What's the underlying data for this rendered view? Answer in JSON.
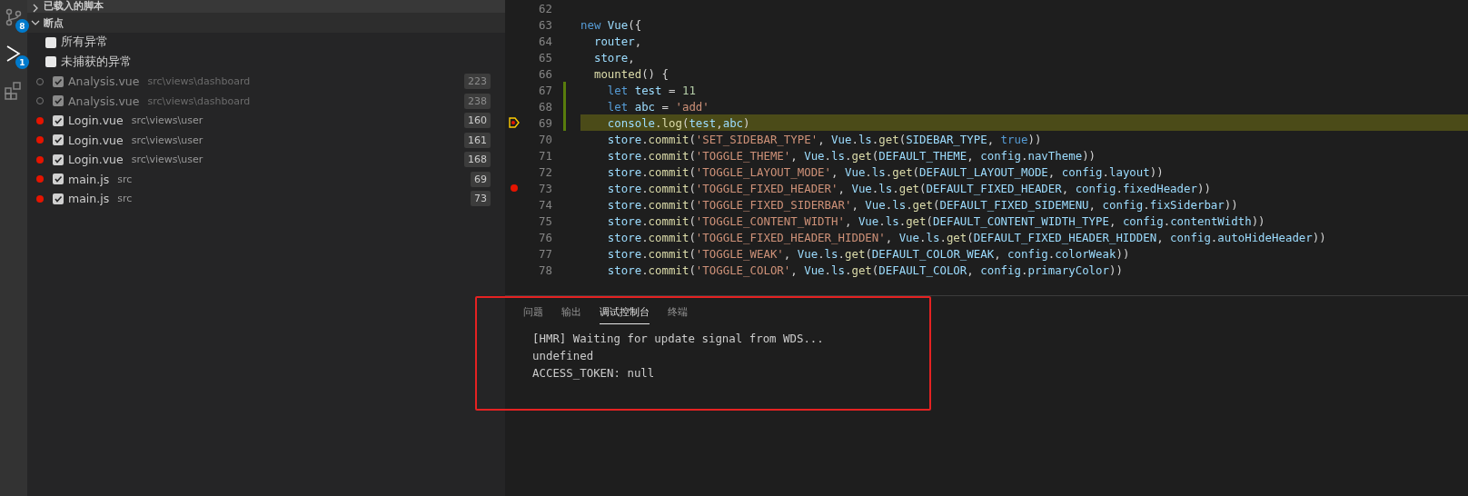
{
  "activity_bar": {
    "badges": [
      {
        "kind": "scm",
        "count": "8"
      },
      {
        "kind": "debug",
        "count": "1"
      },
      {
        "kind": "extensions"
      }
    ]
  },
  "sidebar": {
    "sections": [
      {
        "title": "已载入的脚本",
        "expanded": false
      },
      {
        "title": "断点",
        "expanded": true
      }
    ],
    "breakpoints": [
      {
        "kind": "exception",
        "label": "所有异常",
        "checked": false
      },
      {
        "kind": "exception",
        "label": "未捕获的异常",
        "checked": false
      },
      {
        "kind": "breakpoint",
        "label": "Analysis.vue",
        "path": "src\\views\\dashboard",
        "line": "223",
        "checked": true,
        "verified": false
      },
      {
        "kind": "breakpoint",
        "label": "Analysis.vue",
        "path": "src\\views\\dashboard",
        "line": "238",
        "checked": true,
        "verified": false
      },
      {
        "kind": "breakpoint",
        "label": "Login.vue",
        "path": "src\\views\\user",
        "line": "160",
        "checked": true,
        "verified": true
      },
      {
        "kind": "breakpoint",
        "label": "Login.vue",
        "path": "src\\views\\user",
        "line": "161",
        "checked": true,
        "verified": true
      },
      {
        "kind": "breakpoint",
        "label": "Login.vue",
        "path": "src\\views\\user",
        "line": "168",
        "checked": true,
        "verified": true
      },
      {
        "kind": "breakpoint",
        "label": "main.js",
        "path": "src",
        "line": "69",
        "checked": true,
        "verified": true
      },
      {
        "kind": "breakpoint",
        "label": "main.js",
        "path": "src",
        "line": "73",
        "checked": true,
        "verified": true
      }
    ]
  },
  "editor": {
    "lines": [
      {
        "number": "62",
        "breakpoint": false,
        "current": false,
        "modified": false
      },
      {
        "number": "63",
        "breakpoint": false,
        "current": false,
        "modified": false,
        "tokens": [
          {
            "kind": "keyword",
            "text": "new "
          },
          {
            "kind": "variable",
            "text": "Vue"
          },
          {
            "kind": "plain",
            "text": "({"
          }
        ]
      },
      {
        "number": "64",
        "breakpoint": false,
        "current": false,
        "modified": false,
        "tokens": [
          {
            "kind": "variable",
            "text": "  router"
          },
          {
            "kind": "plain",
            "text": ","
          }
        ]
      },
      {
        "number": "65",
        "breakpoint": false,
        "current": false,
        "modified": false,
        "tokens": [
          {
            "kind": "variable",
            "text": "  store"
          },
          {
            "kind": "plain",
            "text": ","
          }
        ]
      },
      {
        "number": "66",
        "breakpoint": false,
        "current": false,
        "modified": false,
        "tokens": [
          {
            "kind": "function",
            "text": "  mounted"
          },
          {
            "kind": "plain",
            "text": "() {"
          }
        ]
      },
      {
        "number": "67",
        "breakpoint": false,
        "current": false,
        "modified": true,
        "tokens": [
          {
            "kind": "keyword",
            "text": "    let "
          },
          {
            "kind": "variable",
            "text": "test"
          },
          {
            "kind": "plain",
            "text": " = "
          },
          {
            "kind": "number",
            "text": "11"
          }
        ]
      },
      {
        "number": "68",
        "breakpoint": false,
        "current": false,
        "modified": true,
        "tokens": [
          {
            "kind": "keyword",
            "text": "    let "
          },
          {
            "kind": "variable",
            "text": "abc"
          },
          {
            "kind": "plain",
            "text": " = "
          },
          {
            "kind": "string",
            "text": "'add'"
          }
        ]
      },
      {
        "number": "69",
        "breakpoint": true,
        "current": true,
        "modified": true,
        "tokens": [
          {
            "kind": "variable",
            "text": "    console"
          },
          {
            "kind": "plain",
            "text": "."
          },
          {
            "kind": "function",
            "text": "log"
          },
          {
            "kind": "plain",
            "text": "("
          },
          {
            "kind": "variable",
            "text": "test"
          },
          {
            "kind": "plain",
            "text": ","
          },
          {
            "kind": "variable",
            "text": "abc"
          },
          {
            "kind": "plain",
            "text": ")"
          }
        ]
      },
      {
        "number": "70",
        "breakpoint": false,
        "current": false,
        "modified": false,
        "tokens": [
          {
            "kind": "variable",
            "text": "    store"
          },
          {
            "kind": "plain",
            "text": "."
          },
          {
            "kind": "function",
            "text": "commit"
          },
          {
            "kind": "plain",
            "text": "("
          },
          {
            "kind": "string",
            "text": "'SET_SIDEBAR_TYPE'"
          },
          {
            "kind": "plain",
            "text": ", "
          },
          {
            "kind": "variable",
            "text": "Vue"
          },
          {
            "kind": "plain",
            "text": "."
          },
          {
            "kind": "variable",
            "text": "ls"
          },
          {
            "kind": "plain",
            "text": "."
          },
          {
            "kind": "function",
            "text": "get"
          },
          {
            "kind": "plain",
            "text": "("
          },
          {
            "kind": "variable",
            "text": "SIDEBAR_TYPE"
          },
          {
            "kind": "plain",
            "text": ", "
          },
          {
            "kind": "keyword",
            "text": "true"
          },
          {
            "kind": "plain",
            "text": "))"
          }
        ]
      },
      {
        "number": "71",
        "breakpoint": false,
        "current": false,
        "modified": false,
        "tokens": [
          {
            "kind": "variable",
            "text": "    store"
          },
          {
            "kind": "plain",
            "text": "."
          },
          {
            "kind": "function",
            "text": "commit"
          },
          {
            "kind": "plain",
            "text": "("
          },
          {
            "kind": "string",
            "text": "'TOGGLE_THEME'"
          },
          {
            "kind": "plain",
            "text": ", "
          },
          {
            "kind": "variable",
            "text": "Vue"
          },
          {
            "kind": "plain",
            "text": "."
          },
          {
            "kind": "variable",
            "text": "ls"
          },
          {
            "kind": "plain",
            "text": "."
          },
          {
            "kind": "function",
            "text": "get"
          },
          {
            "kind": "plain",
            "text": "("
          },
          {
            "kind": "variable",
            "text": "DEFAULT_THEME"
          },
          {
            "kind": "plain",
            "text": ", "
          },
          {
            "kind": "variable",
            "text": "config"
          },
          {
            "kind": "plain",
            "text": "."
          },
          {
            "kind": "variable",
            "text": "navTheme"
          },
          {
            "kind": "plain",
            "text": "))"
          }
        ]
      },
      {
        "number": "72",
        "breakpoint": false,
        "current": false,
        "modified": false,
        "tokens": [
          {
            "kind": "variable",
            "text": "    store"
          },
          {
            "kind": "plain",
            "text": "."
          },
          {
            "kind": "function",
            "text": "commit"
          },
          {
            "kind": "plain",
            "text": "("
          },
          {
            "kind": "string",
            "text": "'TOGGLE_LAYOUT_MODE'"
          },
          {
            "kind": "plain",
            "text": ", "
          },
          {
            "kind": "variable",
            "text": "Vue"
          },
          {
            "kind": "plain",
            "text": "."
          },
          {
            "kind": "variable",
            "text": "ls"
          },
          {
            "kind": "plain",
            "text": "."
          },
          {
            "kind": "function",
            "text": "get"
          },
          {
            "kind": "plain",
            "text": "("
          },
          {
            "kind": "variable",
            "text": "DEFAULT_LAYOUT_MODE"
          },
          {
            "kind": "plain",
            "text": ", "
          },
          {
            "kind": "variable",
            "text": "config"
          },
          {
            "kind": "plain",
            "text": "."
          },
          {
            "kind": "variable",
            "text": "layout"
          },
          {
            "kind": "plain",
            "text": "))"
          }
        ]
      },
      {
        "number": "73",
        "breakpoint": true,
        "current": false,
        "modified": false,
        "tokens": [
          {
            "kind": "variable",
            "text": "    store"
          },
          {
            "kind": "plain",
            "text": "."
          },
          {
            "kind": "function",
            "text": "commit"
          },
          {
            "kind": "plain",
            "text": "("
          },
          {
            "kind": "string",
            "text": "'TOGGLE_FIXED_HEADER'"
          },
          {
            "kind": "plain",
            "text": ", "
          },
          {
            "kind": "variable",
            "text": "Vue"
          },
          {
            "kind": "plain",
            "text": "."
          },
          {
            "kind": "variable",
            "text": "ls"
          },
          {
            "kind": "plain",
            "text": "."
          },
          {
            "kind": "function",
            "text": "get"
          },
          {
            "kind": "plain",
            "text": "("
          },
          {
            "kind": "variable",
            "text": "DEFAULT_FIXED_HEADER"
          },
          {
            "kind": "plain",
            "text": ", "
          },
          {
            "kind": "variable",
            "text": "config"
          },
          {
            "kind": "plain",
            "text": "."
          },
          {
            "kind": "variable",
            "text": "fixedHeader"
          },
          {
            "kind": "plain",
            "text": "))"
          }
        ]
      },
      {
        "number": "74",
        "breakpoint": false,
        "current": false,
        "modified": false,
        "tokens": [
          {
            "kind": "variable",
            "text": "    store"
          },
          {
            "kind": "plain",
            "text": "."
          },
          {
            "kind": "function",
            "text": "commit"
          },
          {
            "kind": "plain",
            "text": "("
          },
          {
            "kind": "string",
            "text": "'TOGGLE_FIXED_SIDERBAR'"
          },
          {
            "kind": "plain",
            "text": ", "
          },
          {
            "kind": "variable",
            "text": "Vue"
          },
          {
            "kind": "plain",
            "text": "."
          },
          {
            "kind": "variable",
            "text": "ls"
          },
          {
            "kind": "plain",
            "text": "."
          },
          {
            "kind": "function",
            "text": "get"
          },
          {
            "kind": "plain",
            "text": "("
          },
          {
            "kind": "variable",
            "text": "DEFAULT_FIXED_SIDEMENU"
          },
          {
            "kind": "plain",
            "text": ", "
          },
          {
            "kind": "variable",
            "text": "config"
          },
          {
            "kind": "plain",
            "text": "."
          },
          {
            "kind": "variable",
            "text": "fixSiderbar"
          },
          {
            "kind": "plain",
            "text": "))"
          }
        ]
      },
      {
        "number": "75",
        "breakpoint": false,
        "current": false,
        "modified": false,
        "tokens": [
          {
            "kind": "variable",
            "text": "    store"
          },
          {
            "kind": "plain",
            "text": "."
          },
          {
            "kind": "function",
            "text": "commit"
          },
          {
            "kind": "plain",
            "text": "("
          },
          {
            "kind": "string",
            "text": "'TOGGLE_CONTENT_WIDTH'"
          },
          {
            "kind": "plain",
            "text": ", "
          },
          {
            "kind": "variable",
            "text": "Vue"
          },
          {
            "kind": "plain",
            "text": "."
          },
          {
            "kind": "variable",
            "text": "ls"
          },
          {
            "kind": "plain",
            "text": "."
          },
          {
            "kind": "function",
            "text": "get"
          },
          {
            "kind": "plain",
            "text": "("
          },
          {
            "kind": "variable",
            "text": "DEFAULT_CONTENT_WIDTH_TYPE"
          },
          {
            "kind": "plain",
            "text": ", "
          },
          {
            "kind": "variable",
            "text": "config"
          },
          {
            "kind": "plain",
            "text": "."
          },
          {
            "kind": "variable",
            "text": "contentWidth"
          },
          {
            "kind": "plain",
            "text": "))"
          }
        ]
      },
      {
        "number": "76",
        "breakpoint": false,
        "current": false,
        "modified": false,
        "tokens": [
          {
            "kind": "variable",
            "text": "    store"
          },
          {
            "kind": "plain",
            "text": "."
          },
          {
            "kind": "function",
            "text": "commit"
          },
          {
            "kind": "plain",
            "text": "("
          },
          {
            "kind": "string",
            "text": "'TOGGLE_FIXED_HEADER_HIDDEN'"
          },
          {
            "kind": "plain",
            "text": ", "
          },
          {
            "kind": "variable",
            "text": "Vue"
          },
          {
            "kind": "plain",
            "text": "."
          },
          {
            "kind": "variable",
            "text": "ls"
          },
          {
            "kind": "plain",
            "text": "."
          },
          {
            "kind": "function",
            "text": "get"
          },
          {
            "kind": "plain",
            "text": "("
          },
          {
            "kind": "variable",
            "text": "DEFAULT_FIXED_HEADER_HIDDEN"
          },
          {
            "kind": "plain",
            "text": ", "
          },
          {
            "kind": "variable",
            "text": "config"
          },
          {
            "kind": "plain",
            "text": "."
          },
          {
            "kind": "variable",
            "text": "autoHideHeader"
          },
          {
            "kind": "plain",
            "text": "))"
          }
        ]
      },
      {
        "number": "77",
        "breakpoint": false,
        "current": false,
        "modified": false,
        "tokens": [
          {
            "kind": "variable",
            "text": "    store"
          },
          {
            "kind": "plain",
            "text": "."
          },
          {
            "kind": "function",
            "text": "commit"
          },
          {
            "kind": "plain",
            "text": "("
          },
          {
            "kind": "string",
            "text": "'TOGGLE_WEAK'"
          },
          {
            "kind": "plain",
            "text": ", "
          },
          {
            "kind": "variable",
            "text": "Vue"
          },
          {
            "kind": "plain",
            "text": "."
          },
          {
            "kind": "variable",
            "text": "ls"
          },
          {
            "kind": "plain",
            "text": "."
          },
          {
            "kind": "function",
            "text": "get"
          },
          {
            "kind": "plain",
            "text": "("
          },
          {
            "kind": "variable",
            "text": "DEFAULT_COLOR_WEAK"
          },
          {
            "kind": "plain",
            "text": ", "
          },
          {
            "kind": "variable",
            "text": "config"
          },
          {
            "kind": "plain",
            "text": "."
          },
          {
            "kind": "variable",
            "text": "colorWeak"
          },
          {
            "kind": "plain",
            "text": "))"
          }
        ]
      },
      {
        "number": "78",
        "breakpoint": false,
        "current": false,
        "modified": false,
        "tokens": [
          {
            "kind": "variable",
            "text": "    store"
          },
          {
            "kind": "plain",
            "text": "."
          },
          {
            "kind": "function",
            "text": "commit"
          },
          {
            "kind": "plain",
            "text": "("
          },
          {
            "kind": "string",
            "text": "'TOGGLE_COLOR'"
          },
          {
            "kind": "plain",
            "text": ", "
          },
          {
            "kind": "variable",
            "text": "Vue"
          },
          {
            "kind": "plain",
            "text": "."
          },
          {
            "kind": "variable",
            "text": "ls"
          },
          {
            "kind": "plain",
            "text": "."
          },
          {
            "kind": "function",
            "text": "get"
          },
          {
            "kind": "plain",
            "text": "("
          },
          {
            "kind": "variable",
            "text": "DEFAULT_COLOR"
          },
          {
            "kind": "plain",
            "text": ", "
          },
          {
            "kind": "variable",
            "text": "config"
          },
          {
            "kind": "plain",
            "text": "."
          },
          {
            "kind": "variable",
            "text": "primaryColor"
          },
          {
            "kind": "plain",
            "text": "))"
          }
        ]
      }
    ]
  },
  "panel": {
    "tabs": [
      {
        "label": "问题",
        "selected": false
      },
      {
        "label": "输出",
        "selected": false
      },
      {
        "label": "调试控制台",
        "selected": true
      },
      {
        "label": "终端",
        "selected": false
      }
    ],
    "output": [
      "[HMR] Waiting for update signal from WDS...",
      "undefined",
      "ACCESS_TOKEN: null"
    ]
  }
}
